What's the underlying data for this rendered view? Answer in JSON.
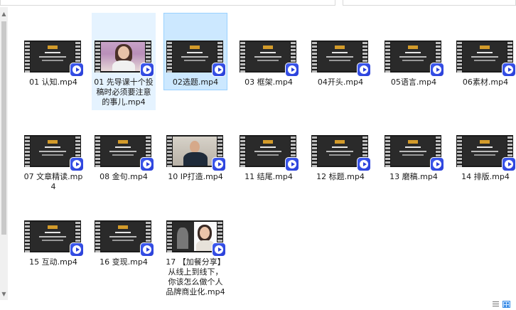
{
  "files": [
    {
      "name": "01 认知.mp4",
      "thumb": "slide",
      "state": "normal"
    },
    {
      "name": "01 先导课十个投稿时必须要注意的事儿.mp4",
      "thumb": "person1",
      "state": "hover"
    },
    {
      "name": "02选题.mp4",
      "thumb": "slide",
      "state": "selected"
    },
    {
      "name": "03 框架.mp4",
      "thumb": "slide",
      "state": "normal"
    },
    {
      "name": "04开头.mp4",
      "thumb": "slide",
      "state": "normal"
    },
    {
      "name": "05语言.mp4",
      "thumb": "slide",
      "state": "normal"
    },
    {
      "name": "06素材.mp4",
      "thumb": "slide",
      "state": "normal"
    },
    {
      "name": "07 文章精读.mp4",
      "thumb": "slide",
      "state": "normal"
    },
    {
      "name": "08 金句.mp4",
      "thumb": "slide",
      "state": "normal"
    },
    {
      "name": "10 IP打造.mp4",
      "thumb": "person2",
      "state": "normal"
    },
    {
      "name": "11 结尾.mp4",
      "thumb": "slide",
      "state": "normal"
    },
    {
      "name": "12 标题.mp4",
      "thumb": "slide",
      "state": "normal"
    },
    {
      "name": "13 磨稿.mp4",
      "thumb": "slide",
      "state": "normal"
    },
    {
      "name": "14 排版.mp4",
      "thumb": "slide",
      "state": "normal"
    },
    {
      "name": "15 互动.mp4",
      "thumb": "slide",
      "state": "normal"
    },
    {
      "name": "16 变现.mp4",
      "thumb": "slide",
      "state": "normal"
    },
    {
      "name": "17 【加餐分享】从线上到线下，你该怎么做个人品牌商业化.mp4",
      "thumb": "person3",
      "state": "normal"
    }
  ],
  "icons": {
    "file_badge": "video-play-icon",
    "view_details": "details-view-icon",
    "view_tiles": "large-icons-view-icon",
    "scroll_up": "scroll-up-arrow-icon",
    "scroll_down": "scroll-down-arrow-icon"
  },
  "colors": {
    "selected_bg": "#cce8ff",
    "hover_bg": "#e5f3ff",
    "play_badge": "#2a3fd8"
  }
}
